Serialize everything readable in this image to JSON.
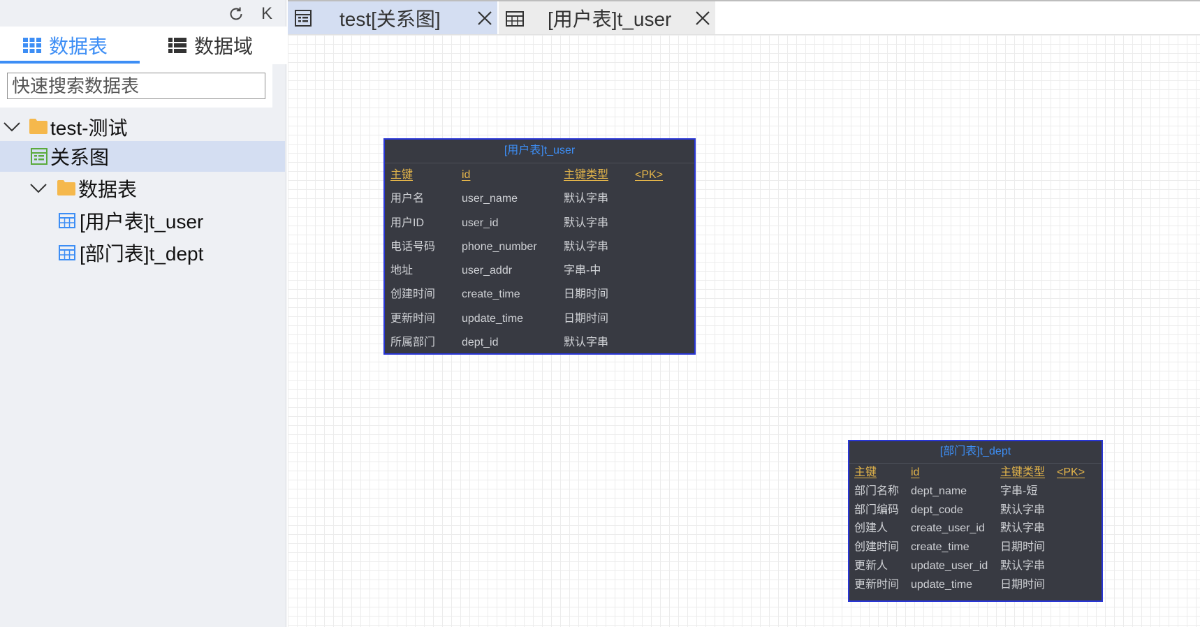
{
  "sidebar": {
    "tools": {
      "refresh_icon": "refresh-icon",
      "collapse_label": "K"
    },
    "tabs": [
      {
        "label": "数据表",
        "icon": "grid-icon",
        "active": true
      },
      {
        "label": "数据域",
        "icon": "list-icon",
        "active": false
      }
    ],
    "search": {
      "placeholder": "快速搜索数据表",
      "value": ""
    },
    "tree": [
      {
        "label": "test-测试",
        "icon": "folder-icon",
        "expanded": true
      },
      {
        "label": "关系图",
        "icon": "diagram-icon",
        "selected": true
      },
      {
        "label": "数据表",
        "icon": "folder-icon",
        "expanded": true
      },
      {
        "label": "[用户表]t_user",
        "icon": "table-icon"
      },
      {
        "label": "[部门表]t_dept",
        "icon": "table-icon"
      }
    ]
  },
  "tabs": [
    {
      "label": "test[关系图]",
      "icon": "diagram-icon",
      "active": true
    },
    {
      "label": "[用户表]t_user",
      "icon": "table-icon",
      "active": false
    }
  ],
  "diagram": {
    "tables": [
      {
        "title": "[用户表]t_user",
        "header": [
          "主键",
          "id",
          "主键类型",
          "<PK>"
        ],
        "rows": [
          [
            "用户名",
            "user_name",
            "默认字串"
          ],
          [
            "用户ID",
            "user_id",
            "默认字串"
          ],
          [
            "电话号码",
            "phone_number",
            "默认字串"
          ],
          [
            "地址",
            "user_addr",
            "字串-中"
          ],
          [
            "创建时间",
            "create_time",
            "日期时间"
          ],
          [
            "更新时间",
            "update_time",
            "日期时间"
          ],
          [
            "所属部门",
            "dept_id",
            "默认字串"
          ]
        ]
      },
      {
        "title": "[部门表]t_dept",
        "header": [
          "主键",
          "id",
          "主键类型",
          "<PK>"
        ],
        "rows": [
          [
            "部门名称",
            "dept_name",
            "字串-短"
          ],
          [
            "部门编码",
            "dept_code",
            "默认字串"
          ],
          [
            "创建人",
            "create_user_id",
            "默认字串"
          ],
          [
            "创建时间",
            "create_time",
            "日期时间"
          ],
          [
            "更新人",
            "update_user_id",
            "默认字串"
          ],
          [
            "更新时间",
            "update_time",
            "日期时间"
          ]
        ]
      }
    ]
  },
  "colors": {
    "accent": "#3d8ef5",
    "selection": "#d4def2",
    "folder": "#f5b84c",
    "table_icon": "#3d8ef5",
    "diagram_icon": "#5aaa3c",
    "er_background": "#383a42",
    "er_border": "#2936d6",
    "er_key": "#e4b54a"
  }
}
